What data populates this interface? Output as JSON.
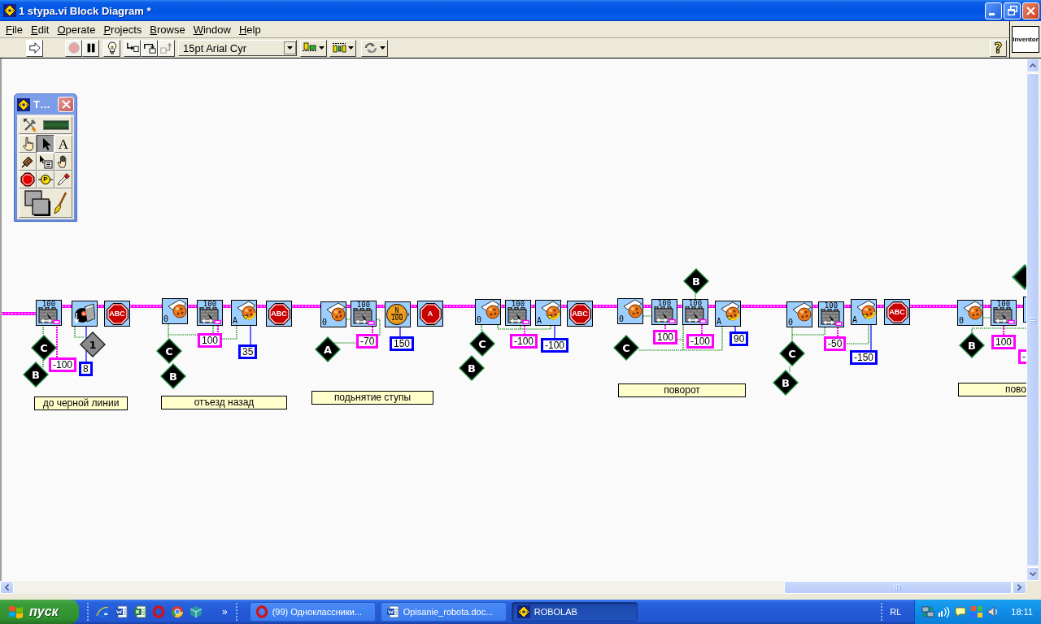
{
  "window": {
    "title": "1 stypa.vi Block Diagram *",
    "controls": [
      {
        "kind": "minimize"
      },
      {
        "kind": "restore"
      },
      {
        "kind": "close"
      }
    ]
  },
  "menu": [
    "File",
    "Edit",
    "Operate",
    "Projects",
    "Browse",
    "Window",
    "Help"
  ],
  "toolbar": {
    "buttons": [
      {
        "kind": "run",
        "disabled": false
      },
      {
        "kind": "abort",
        "disabled": true
      },
      {
        "kind": "pause",
        "disabled": false
      },
      {
        "kind": "highlight",
        "disabled": false
      },
      {
        "kind": "step-into",
        "disabled": false
      },
      {
        "kind": "step-over",
        "disabled": false
      },
      {
        "kind": "step-out",
        "disabled": true
      }
    ],
    "font": "15pt Arial Cyr",
    "arrange": [
      {
        "kind": "align"
      },
      {
        "kind": "distribute"
      },
      {
        "kind": "reorder"
      }
    ],
    "help": "?"
  },
  "level_badge": "Inventor",
  "tools_palette": {
    "title": "T…",
    "auto_tool": {
      "on": false
    },
    "tools": [
      {
        "kind": "operate",
        "selected": false
      },
      {
        "kind": "position",
        "selected": true
      },
      {
        "kind": "label",
        "selected": false,
        "glyph": "A"
      },
      {
        "kind": "wiring",
        "selected": false
      },
      {
        "kind": "shortcut",
        "selected": false
      },
      {
        "kind": "scroll",
        "selected": false
      },
      {
        "kind": "breakpoint",
        "selected": false
      },
      {
        "kind": "probe",
        "selected": false,
        "glyph": "P"
      },
      {
        "kind": "color-copy",
        "selected": false
      },
      {
        "kind": "coloring",
        "selected": false
      }
    ]
  },
  "diagram": {
    "segments": [
      {
        "blocks": [
          {
            "kind": "motor",
            "labels": [
              "100"
            ]
          },
          {
            "kind": "light-wait"
          },
          {
            "kind": "stop",
            "labels": [
              "ABC"
            ]
          }
        ],
        "terminals": [
          {
            "kind": "motor",
            "port": "C"
          },
          {
            "kind": "motor",
            "port": "B"
          },
          {
            "kind": "sensor",
            "port": "1"
          }
        ],
        "constants": [
          {
            "kind": "power",
            "value": "-100"
          },
          {
            "kind": "count",
            "value": "8"
          }
        ],
        "comment": "до черной линии"
      },
      {
        "blocks": [
          {
            "kind": "reset",
            "labels": [
              "0"
            ]
          },
          {
            "kind": "motor",
            "labels": [
              "100"
            ]
          },
          {
            "kind": "rotation-wait",
            "labels": [
              "A"
            ]
          },
          {
            "kind": "stop",
            "labels": [
              "ABC"
            ]
          }
        ],
        "terminals": [
          {
            "kind": "motor",
            "port": "C"
          },
          {
            "kind": "motor",
            "port": "B"
          }
        ],
        "constants": [
          {
            "kind": "power",
            "value": "100"
          },
          {
            "kind": "count",
            "value": "35"
          }
        ],
        "comment": "отъезд назад"
      },
      {
        "blocks": [
          {
            "kind": "reset",
            "labels": [
              "0"
            ]
          },
          {
            "kind": "motor",
            "labels": [
              "100"
            ]
          },
          {
            "kind": "timer-wait",
            "labels": [
              "N",
              "100"
            ]
          },
          {
            "kind": "stop",
            "labels": [
              "A"
            ]
          }
        ],
        "terminals": [
          {
            "kind": "motor",
            "port": "A"
          }
        ],
        "constants": [
          {
            "kind": "power",
            "value": "-70"
          },
          {
            "kind": "count",
            "value": "150"
          }
        ],
        "comment": "подьнятие ступы"
      },
      {
        "blocks": [
          {
            "kind": "reset",
            "labels": [
              "0"
            ]
          },
          {
            "kind": "motor",
            "labels": [
              "100"
            ]
          },
          {
            "kind": "rotation-wait",
            "labels": [
              "A"
            ]
          },
          {
            "kind": "stop",
            "labels": [
              "ABC"
            ]
          }
        ],
        "terminals": [
          {
            "kind": "motor",
            "port": "C"
          },
          {
            "kind": "motor",
            "port": "B"
          }
        ],
        "constants": [
          {
            "kind": "power",
            "value": "-100"
          },
          {
            "kind": "count",
            "value": "-100"
          }
        ]
      },
      {
        "blocks": [
          {
            "kind": "reset",
            "labels": [
              "0"
            ]
          },
          {
            "kind": "motor",
            "labels": [
              "100"
            ]
          },
          {
            "kind": "motor",
            "labels": [
              "100"
            ]
          },
          {
            "kind": "rotation-wait",
            "labels": [
              "A"
            ]
          }
        ],
        "terminals": [
          {
            "kind": "motor",
            "port": "B"
          },
          {
            "kind": "motor",
            "port": "C"
          }
        ],
        "constants": [
          {
            "kind": "power",
            "value": "100"
          },
          {
            "kind": "power",
            "value": "-100"
          },
          {
            "kind": "count",
            "value": "90"
          }
        ],
        "comment": "поворот"
      },
      {
        "blocks": [
          {
            "kind": "reset",
            "labels": [
              "0"
            ]
          },
          {
            "kind": "motor",
            "labels": [
              "100"
            ]
          },
          {
            "kind": "rotation-wait",
            "labels": [
              "A"
            ]
          },
          {
            "kind": "stop",
            "labels": [
              "ABC"
            ]
          }
        ],
        "terminals": [
          {
            "kind": "motor",
            "port": "C"
          },
          {
            "kind": "motor",
            "port": "B"
          }
        ],
        "constants": [
          {
            "kind": "power",
            "value": "-50"
          },
          {
            "kind": "count",
            "value": "-150"
          }
        ]
      },
      {
        "blocks": [
          {
            "kind": "reset",
            "labels": [
              "0"
            ]
          },
          {
            "kind": "motor",
            "labels": [
              "100"
            ]
          },
          {
            "kind": "partial"
          }
        ],
        "terminals": [
          {
            "kind": "partial"
          },
          {
            "kind": "motor",
            "port": "B"
          }
        ],
        "constants": [
          {
            "kind": "power",
            "value": "100"
          },
          {
            "kind": "power",
            "value": "-"
          }
        ],
        "comment": "пово"
      }
    ]
  },
  "taskbar": {
    "start": "пуск",
    "quick_launch": [
      {
        "kind": "e-globe"
      },
      {
        "kind": "w-page"
      },
      {
        "kind": "x-sheet"
      },
      {
        "kind": "o-ring"
      },
      {
        "kind": "color-ball"
      },
      {
        "kind": "box"
      }
    ],
    "overflow": "»",
    "tasks": [
      {
        "kind": "o-ring",
        "label": "(99) Одноклассники...",
        "selected": false
      },
      {
        "kind": "w-page",
        "label": "Opisanie_robota.doc...",
        "selected": false
      },
      {
        "kind": "logo",
        "label": "ROBOLAB",
        "selected": true
      }
    ],
    "language": "RL",
    "tray": [
      {
        "kind": "network"
      },
      {
        "kind": "signal"
      },
      {
        "kind": "bubble"
      },
      {
        "kind": "squares"
      },
      {
        "kind": "speaker"
      }
    ],
    "clock": "18:11"
  }
}
